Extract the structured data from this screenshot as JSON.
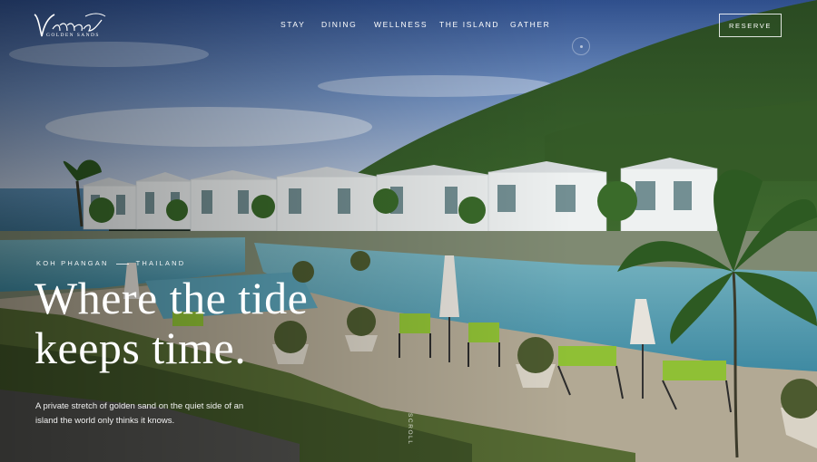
{
  "brand": {
    "wordmark": "Vinnee",
    "subline": "GOLDEN SANDS"
  },
  "nav": {
    "items": [
      {
        "label": "STAY"
      },
      {
        "label": "DINING"
      },
      {
        "label": "WELLNESS"
      },
      {
        "label": "THE ISLAND"
      },
      {
        "label": "GATHER"
      }
    ],
    "cta_label": "RESERVE"
  },
  "hero": {
    "location_left": "KOH PHANGAN",
    "location_right": "THAILAND",
    "headline_line1": "Where the tide",
    "headline_line2": "keeps time.",
    "lede": "A private stretch of golden sand on the quiet side of an island the world only thinks it knows.",
    "scroll_label": "SCROLL"
  },
  "colors": {
    "sky_top": "#3b5f9e",
    "sky_bottom": "#c7d6ea",
    "hill": "#2c4a23",
    "pool": "#4f9bb0",
    "lawn": "#6e8a3a",
    "villa": "#eef1f1",
    "cushion": "#8fc035"
  }
}
